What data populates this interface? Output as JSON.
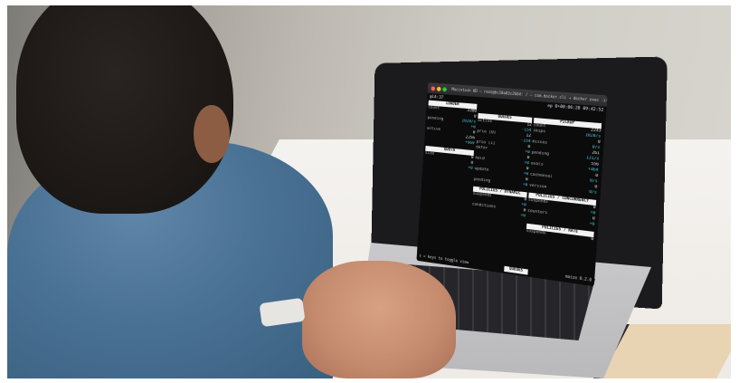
{
  "window": {
    "title": "Macintosh HD — root@6c18a83c2664: / — com.docker.cli ◂ docker exec -it..."
  },
  "terminal": {
    "timestamp_left": "@14:37",
    "ep_label": "ep 0+00:06:28",
    "clock": "09:42:52",
    "left": {
      "panel_title": "LOADER",
      "rows": [
        {
          "label": "count",
          "value": "3380"
        },
        {
          "label": "",
          "value": "0"
        },
        {
          "label": "pending",
          "value": "1028/s"
        },
        {
          "label": "",
          "value": "+0"
        },
        {
          "label": "active",
          "value": "0"
        },
        {
          "label": "",
          "value": "2256"
        },
        {
          "label": "",
          "value": "+969"
        }
      ],
      "panel_title_2": "QUOTA",
      "rows_2": [
        {
          "label": "size",
          "value": "0"
        },
        {
          "label": "",
          "value": "0"
        },
        {
          "label": "",
          "value": "+0"
        }
      ]
    },
    "mid": {
      "panel_title": "QUEUES",
      "rows": [
        {
          "label": "active",
          "value": "12"
        },
        {
          "label": "",
          "value": "-154"
        },
        {
          "label": "prio [0]",
          "value": "12"
        },
        {
          "label": "",
          "value": "-154"
        },
        {
          "label": "prio [1]",
          "value": "0"
        },
        {
          "label": "defer",
          "value": "+0"
        },
        {
          "label": "",
          "value": "0"
        },
        {
          "label": "hold",
          "value": "+0"
        },
        {
          "label": "",
          "value": "0"
        },
        {
          "label": "update",
          "value": "+0"
        },
        {
          "label": "",
          "value": "0"
        },
        {
          "label": "pending",
          "value": "+0"
        }
      ],
      "panel_title_2": "POLICIES / DYNAMIC",
      "rows_2": [
        {
          "label": "suspends",
          "value": "0"
        },
        {
          "label": "",
          "value": "+0"
        },
        {
          "label": "conditions",
          "value": "0"
        },
        {
          "label": "",
          "value": "+0"
        }
      ]
    },
    "right": {
      "panel_title": "PICKUP",
      "rows": [
        {
          "label": "count",
          "value": "2243"
        },
        {
          "label": "skips",
          "value": "1028/s"
        },
        {
          "label": "",
          "value": "0"
        },
        {
          "label": "misses",
          "value": "0/s"
        },
        {
          "label": "",
          "value": "261"
        },
        {
          "label": "pending",
          "value": "131/s"
        },
        {
          "label": "",
          "value": "556"
        },
        {
          "label": "evals",
          "value": "+464"
        },
        {
          "label": "",
          "value": "0"
        },
        {
          "label": "cacheeval",
          "value": "0/s"
        },
        {
          "label": "",
          "value": "0"
        },
        {
          "label": "version",
          "value": "0/s"
        }
      ],
      "panel_title_2": "POLICIES / CONCURRENCY",
      "rows_2": [
        {
          "label": "suspends",
          "value": "0"
        },
        {
          "label": "",
          "value": "+0"
        },
        {
          "label": "counters",
          "value": "0"
        },
        {
          "label": "",
          "value": "+0"
        }
      ],
      "panel_title_3": "POLICIES / RATE",
      "rows_3": [
        {
          "label": "suspends",
          "value": "0"
        }
      ]
    },
    "bottom": {
      "hint": "s = keys to toggle view",
      "center": "QUEUES",
      "version": "maize 0.2.0"
    }
  }
}
